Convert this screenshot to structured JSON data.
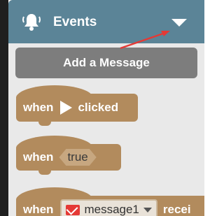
{
  "header": {
    "title": "Events",
    "icon": "bell-icon",
    "dropdown_icon": "caret-down-icon",
    "color": "#5b8497"
  },
  "add_message_button": {
    "label": "Add a Message",
    "color": "#7d7d7d"
  },
  "blocks": [
    {
      "id": "when-clicked",
      "prefix": "when",
      "icon": "play-icon",
      "suffix": "clicked",
      "color": "#b28b5d"
    },
    {
      "id": "when-condition",
      "prefix": "when",
      "input_value": "true",
      "color": "#b28b5d"
    },
    {
      "id": "when-message-received",
      "prefix": "when",
      "message_icon": "envelope-icon",
      "message_value": "message1",
      "suffix": "recei",
      "color": "#b28b5d"
    }
  ],
  "annotation": {
    "arrow_color": "#e53935"
  }
}
